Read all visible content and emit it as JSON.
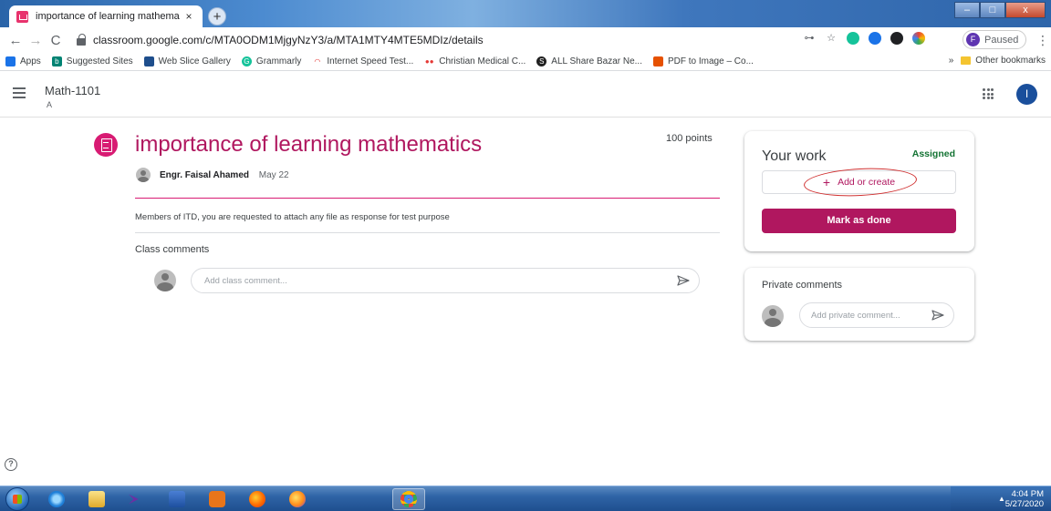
{
  "browser": {
    "tab_title": "importance of learning mathema",
    "tab_close": "×",
    "new_tab": "+",
    "window_controls": {
      "minimize": "–",
      "maximize": "□",
      "close": "x"
    },
    "url": "classroom.google.com/c/MTA0ODM1MjgyNzY3/a/MTA1MTY4MTE5MDIz/details",
    "profile_initial": "F",
    "profile_status": "Paused",
    "bookmarks": [
      {
        "label": "Apps",
        "icon": "apps-grid-icon",
        "color": "#1a73e8"
      },
      {
        "label": "Suggested Sites",
        "icon": "bing-icon",
        "color": "#008373"
      },
      {
        "label": "Web Slice Gallery",
        "icon": "web-slice-icon",
        "color": "#1e4e8c"
      },
      {
        "label": "Grammarly",
        "icon": "grammarly-icon",
        "color": "#15c39a"
      },
      {
        "label": "Internet Speed Test...",
        "icon": "speedtest-icon",
        "color": "#e53935"
      },
      {
        "label": "Christian Medical C...",
        "icon": "cmc-icon",
        "color": "#e53935"
      },
      {
        "label": "ALL Share Bazar Ne...",
        "icon": "share-bazar-icon",
        "color": "#212121"
      },
      {
        "label": "PDF to Image – Co...",
        "icon": "pdf-icon",
        "color": "#e65100"
      }
    ],
    "bookmarks_overflow": "»",
    "other_bookmarks": "Other bookmarks"
  },
  "classroom": {
    "class_name": "Math-1101",
    "class_section": "A",
    "account_initial": "I",
    "assignment": {
      "title": "importance of learning mathematics",
      "points": "100 points",
      "author": "Engr. Faisal Ahamed",
      "date": "May 22",
      "description": "Members of ITD, you are requested to attach any file as response for test purpose",
      "comments_label": "Class comments",
      "comment_placeholder": "Add class comment..."
    },
    "your_work": {
      "title": "Your work",
      "status": "Assigned",
      "status_color": "#137333",
      "add_label": "Add or create",
      "add_icon": "+",
      "done_label": "Mark as done"
    },
    "private": {
      "title": "Private comments",
      "placeholder": "Add private comment..."
    },
    "help_glyph": "?",
    "accent_color": "#b0175f"
  },
  "taskbar": {
    "apps": [
      "start-orb",
      "internet-explorer",
      "file-explorer",
      "visual-studio",
      "word",
      "media-player",
      "firefox",
      "firefox-developer",
      "chrome"
    ],
    "time": "4:04 PM",
    "date": "5/27/2020",
    "tray_arrow": "▲"
  }
}
